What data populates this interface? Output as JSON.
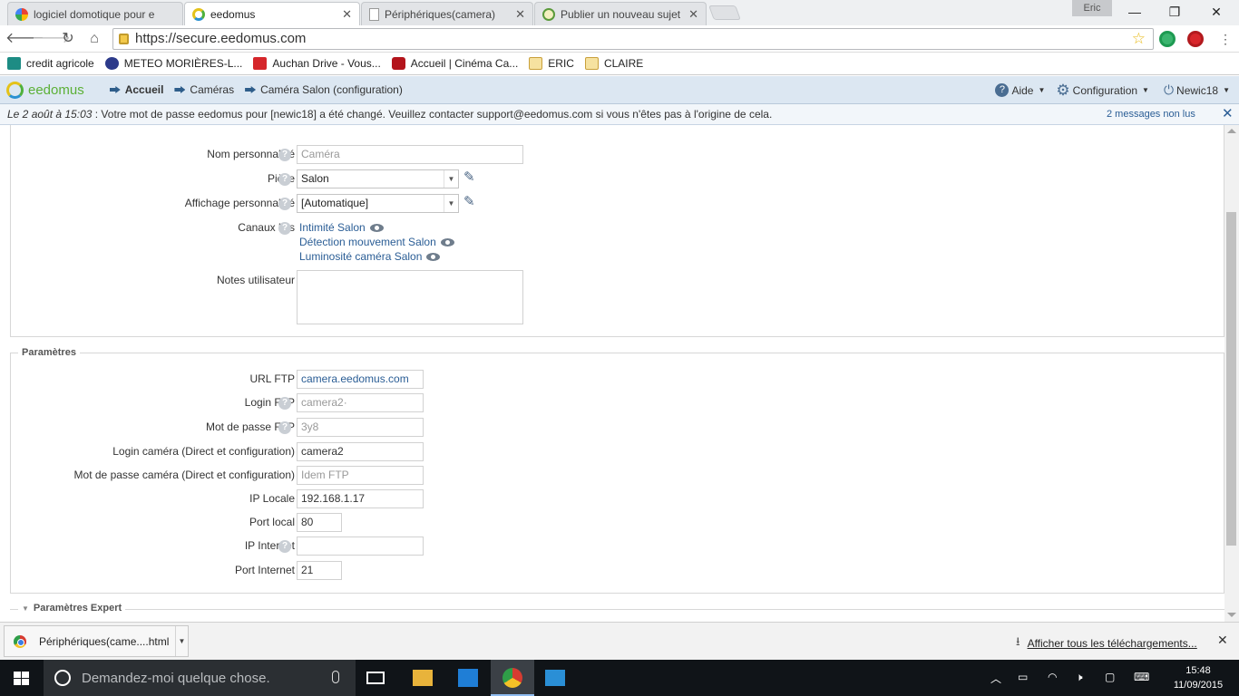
{
  "browser": {
    "tabs": [
      {
        "title": "logiciel domotique pour e",
        "icon": "google-icon",
        "active": false
      },
      {
        "title": "eedomus",
        "icon": "eedomus-icon",
        "active": true
      },
      {
        "title": "Périphériques(camera)",
        "icon": "page-icon",
        "active": false
      },
      {
        "title": "Publier un nouveau sujet",
        "icon": "forum-icon",
        "active": false
      }
    ],
    "profile_name": "Eric",
    "url": "https://secure.eedomus.com",
    "bookmarks": [
      {
        "label": "credit agricole",
        "icon": "credit-agricole-icon"
      },
      {
        "label": "METEO MORIÈRES-L...",
        "icon": "meteo-icon"
      },
      {
        "label": "Auchan Drive - Vous...",
        "icon": "auchan-icon"
      },
      {
        "label": "Accueil | Cinéma Ca...",
        "icon": "cinema-icon"
      },
      {
        "label": "ERIC",
        "icon": "folder-icon"
      },
      {
        "label": "CLAIRE",
        "icon": "folder-icon"
      }
    ]
  },
  "header": {
    "logo": "eedomus",
    "breadcrumb": [
      "Accueil",
      "Caméras",
      "Caméra Salon (configuration)"
    ],
    "help_label": "Aide",
    "config_label": "Configuration",
    "user_label": "Newic18"
  },
  "message": {
    "date": "Le 2 août à 15:03",
    "text": " : Votre mot de passe eedomus pour [newic18] a été changé. Veuillez contacter support@eedomus.com si vous n'êtes pas à l'origine de cela.",
    "unread": "2 messages non lus",
    "close": "✕"
  },
  "general": {
    "nom_label": "Nom personnalisé",
    "nom_placeholder": "Caméra",
    "piece_label": "Pièce",
    "piece_value": "Salon",
    "affichage_label": "Affichage personnalisé",
    "affichage_value": "[Automatique]",
    "canaux_label": "Canaux liés",
    "canaux": [
      "Intimité Salon",
      "Détection mouvement Salon",
      "Luminosité caméra Salon"
    ],
    "notes_label": "Notes utilisateur"
  },
  "parametres": {
    "legend": "Paramètres",
    "fields": [
      {
        "label": "URL FTP",
        "value": "camera.eedomus.com",
        "help": false,
        "style": "link",
        "w": "medium"
      },
      {
        "label": "Login FTP",
        "value": "camera2·",
        "help": true,
        "style": "ph",
        "w": "medium"
      },
      {
        "label": "Mot de passe FTP",
        "value": "3y8",
        "help": true,
        "style": "ph",
        "w": "medium"
      },
      {
        "label": "Login caméra (Direct et configuration)",
        "value": "camera2",
        "help": false,
        "style": "",
        "w": "medium"
      },
      {
        "label": "Mot de passe caméra (Direct et configuration)",
        "value": "Idem FTP",
        "help": false,
        "style": "ph",
        "w": "medium"
      },
      {
        "label": "IP Locale",
        "value": "192.168.1.17",
        "help": false,
        "style": "",
        "w": "medium"
      },
      {
        "label": "Port local",
        "value": "80",
        "help": false,
        "style": "",
        "w": "small"
      },
      {
        "label": "IP Internet",
        "value": "",
        "help": true,
        "style": "",
        "w": "medium"
      },
      {
        "label": "Port Internet",
        "value": "21",
        "help": false,
        "style": "",
        "w": "small"
      }
    ],
    "expert_legend": "Paramètres Expert"
  },
  "downloads": {
    "file": "Périphériques(came....html",
    "show_all": "Afficher tous les téléchargements..."
  },
  "taskbar": {
    "search_placeholder": "Demandez-moi quelque chose.",
    "time": "15:48",
    "date": "11/09/2015"
  }
}
